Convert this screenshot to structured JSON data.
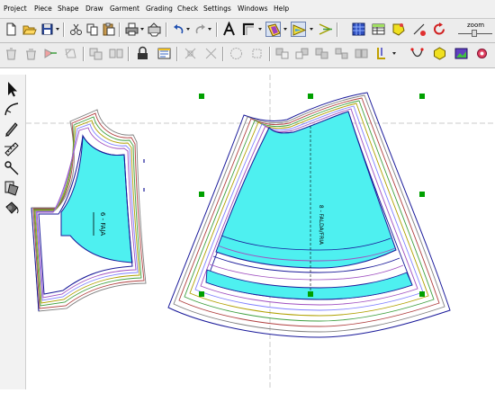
{
  "menu": [
    "Project",
    "Piece",
    "Shape",
    "Draw",
    "Garment",
    "Grading",
    "Check",
    "Settings",
    "Windows",
    "Help"
  ],
  "zoom": {
    "label": "zoom"
  },
  "pieces": [
    {
      "label": "6 - FAJA"
    },
    {
      "label": "8 - FALDA/FRIA"
    }
  ],
  "colors": {
    "fill": "#4ef0f0",
    "selection_handle": "#00a000",
    "outline": "#1a1a9a",
    "grade_lines": [
      "#1a1a9a",
      "#a050c0",
      "#8080ff",
      "#b0a000",
      "#b04040",
      "#40a040",
      "#808080"
    ]
  }
}
